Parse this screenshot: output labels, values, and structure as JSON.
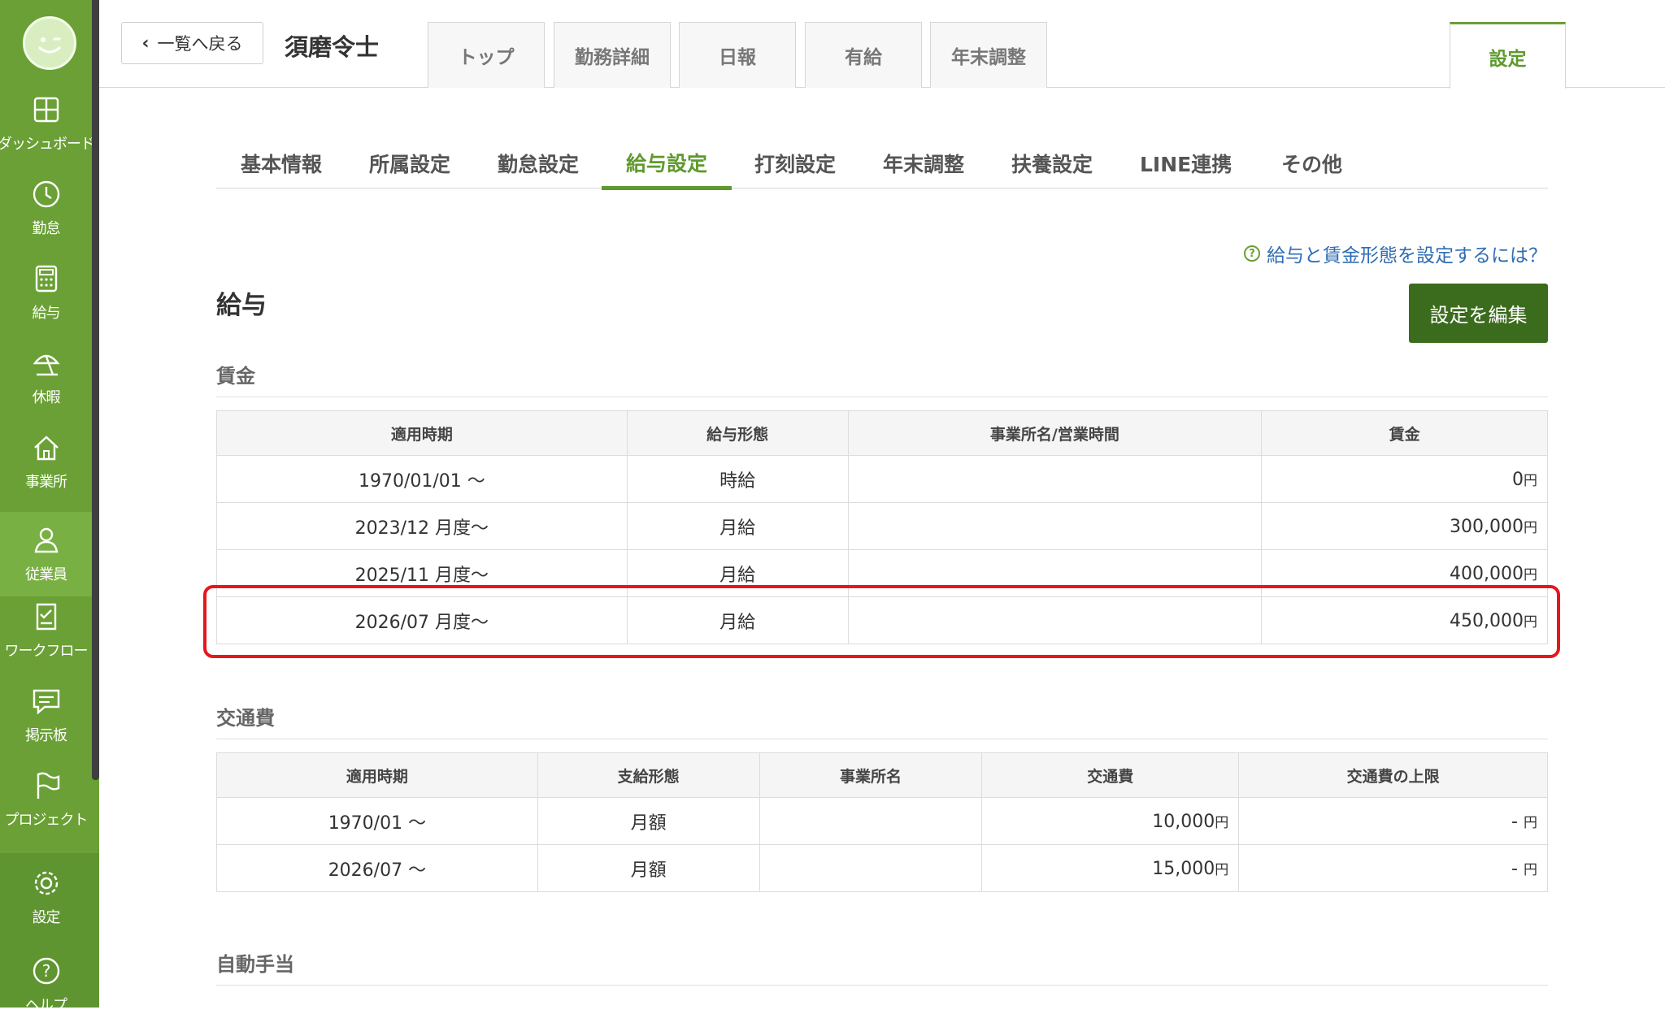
{
  "sidebar": {
    "items": [
      {
        "label": "ダッシュボード",
        "icon": "dashboard-icon"
      },
      {
        "label": "勤怠",
        "icon": "clock-icon"
      },
      {
        "label": "給与",
        "icon": "calculator-icon"
      },
      {
        "label": "休暇",
        "icon": "parasol-icon"
      },
      {
        "label": "事業所",
        "icon": "home-icon"
      },
      {
        "label": "従業員",
        "icon": "person-icon",
        "active": true
      },
      {
        "label": "ワークフロー",
        "icon": "checklist-icon"
      },
      {
        "label": "掲示板",
        "icon": "message-icon"
      },
      {
        "label": "プロジェクト",
        "icon": "flag-icon"
      },
      {
        "label": "設定",
        "icon": "gear-icon"
      },
      {
        "label": "ヘルプ",
        "icon": "help-icon"
      }
    ]
  },
  "header": {
    "back_label": "一覧へ戻る",
    "employee_name": "須磨令士",
    "tabs": [
      "トップ",
      "勤務詳細",
      "日報",
      "有給",
      "年末調整"
    ],
    "settings_tab": "設定"
  },
  "subtabs": [
    "基本情報",
    "所属設定",
    "勤怠設定",
    "給与設定",
    "打刻設定",
    "年末調整",
    "扶養設定",
    "LINE連携",
    "その他"
  ],
  "help_link": "給与と賃金形態を設定するには？",
  "page_title": "給与",
  "edit_button": "設定を編集",
  "wage": {
    "title": "賃金",
    "headers": [
      "適用時期",
      "給与形態",
      "事業所名/営業時間",
      "賃金"
    ],
    "rows": [
      {
        "period": "1970/01/01 〜",
        "type": "時給",
        "office": "",
        "amount": "0",
        "unit": "円"
      },
      {
        "period": "2023/12 月度〜",
        "type": "月給",
        "office": "",
        "amount": "300,000",
        "unit": "円"
      },
      {
        "period": "2025/11 月度〜",
        "type": "月給",
        "office": "",
        "amount": "400,000",
        "unit": "円"
      },
      {
        "period": "2026/07 月度〜",
        "type": "月給",
        "office": "",
        "amount": "450,000",
        "unit": "円"
      }
    ]
  },
  "transport": {
    "title": "交通費",
    "headers": [
      "適用時期",
      "支給形態",
      "事業所名",
      "交通費",
      "交通費の上限"
    ],
    "rows": [
      {
        "period": "1970/01 〜",
        "type": "月額",
        "office": "",
        "amount": "10,000",
        "unit": "円",
        "limit": "-",
        "limit_unit": "円"
      },
      {
        "period": "2026/07 〜",
        "type": "月額",
        "office": "",
        "amount": "15,000",
        "unit": "円",
        "limit": "-",
        "limit_unit": "円"
      }
    ]
  },
  "auto_allowance": {
    "title": "自動手当"
  },
  "colors": {
    "sidebar": "#6aa035",
    "accent": "#5e9a2d",
    "edit_button": "#3b6b1c",
    "highlight": "#e8161c",
    "link": "#2f6db3"
  }
}
